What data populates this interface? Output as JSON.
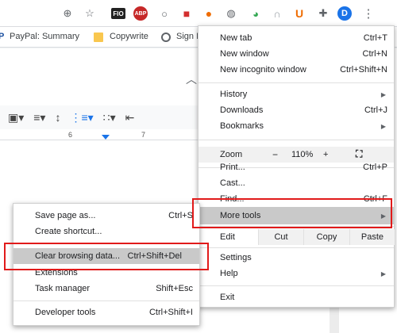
{
  "toolbar": {
    "ext_fio": "FIO",
    "ext_abp": "ABP",
    "ext_u": "U",
    "avatar": "D"
  },
  "bookmarks": {
    "items": [
      "PayPal: Summary",
      "Copywrite",
      "Sign I"
    ]
  },
  "ruler": {
    "mark6": "6",
    "mark7": "7"
  },
  "main_menu": {
    "new_tab": {
      "label": "New tab",
      "shortcut": "Ctrl+T"
    },
    "new_window": {
      "label": "New window",
      "shortcut": "Ctrl+N"
    },
    "new_incognito": {
      "label": "New incognito window",
      "shortcut": "Ctrl+Shift+N"
    },
    "history": {
      "label": "History"
    },
    "downloads": {
      "label": "Downloads",
      "shortcut": "Ctrl+J"
    },
    "bookmarks": {
      "label": "Bookmarks"
    },
    "zoom": {
      "label": "Zoom",
      "minus": "−",
      "value": "110%",
      "plus": "+"
    },
    "print": {
      "label": "Print...",
      "shortcut": "Ctrl+P"
    },
    "cast": {
      "label": "Cast..."
    },
    "find": {
      "label": "Find...",
      "shortcut": "Ctrl+F"
    },
    "more_tools": {
      "label": "More tools"
    },
    "edit": {
      "label": "Edit",
      "cut": "Cut",
      "copy": "Copy",
      "paste": "Paste"
    },
    "settings": {
      "label": "Settings"
    },
    "help": {
      "label": "Help"
    },
    "exit": {
      "label": "Exit"
    }
  },
  "sub_menu": {
    "save_page": {
      "label": "Save page as...",
      "shortcut": "Ctrl+S"
    },
    "create_shortcut": {
      "label": "Create shortcut..."
    },
    "clear_browsing": {
      "label": "Clear browsing data...",
      "shortcut": "Ctrl+Shift+Del"
    },
    "extensions": {
      "label": "Extensions"
    },
    "task_manager": {
      "label": "Task manager",
      "shortcut": "Shift+Esc"
    },
    "developer_tools": {
      "label": "Developer tools",
      "shortcut": "Ctrl+Shift+I"
    }
  },
  "colors": {
    "highlight": "#c9c9c9",
    "annotation_red": "#e11a1a",
    "avatar_blue": "#1a73e8"
  }
}
